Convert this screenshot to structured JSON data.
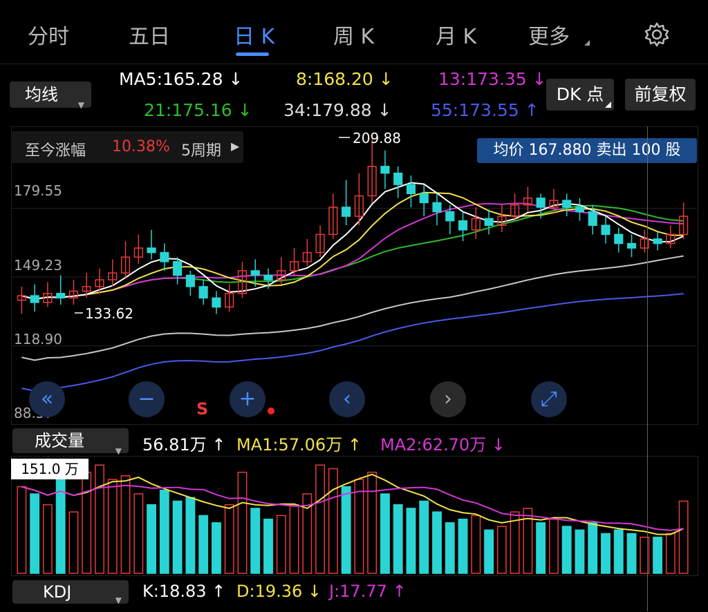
{
  "tabs": [
    {
      "label": "分时"
    },
    {
      "label": "五日"
    },
    {
      "label": "日 K"
    },
    {
      "label": "周 K"
    },
    {
      "label": "月 K"
    },
    {
      "label": "更多"
    }
  ],
  "ma_selector": "均线",
  "ma": {
    "ma5": "MA5:165.28 ↓",
    "ma8": "8:168.20 ↓",
    "ma13": "13:173.35 ↓",
    "ma21": "21:175.16 ↓",
    "ma34": "34:179.88 ↓",
    "ma55": "55:173.55 ↑"
  },
  "colors": {
    "ma5": "#ffffff",
    "ma8": "#f2e24a",
    "ma13": "#d436d4",
    "ma21": "#2dbb2d",
    "ma34": "#c8c8c8",
    "ma55": "#4a5ae8",
    "up": "#e83a3a",
    "down": "#2ad4d4",
    "accent": "#4a8cff"
  },
  "dk_button": "DK 点",
  "restore_button": "前复权",
  "gain": {
    "label": "至今涨幅",
    "value": "10.38%",
    "period": "5周期"
  },
  "avg_tooltip": "均价 167.880 卖出 100 股",
  "price_labels": [
    "179.55",
    "149.23",
    "118.90",
    "88.57"
  ],
  "annotations": {
    "high": "209.88",
    "low": "133.62"
  },
  "signal_s": "S",
  "volume": {
    "selector": "成交量",
    "value": "56.81万 ↑",
    "ma1": "MA1:57.06万 ↑",
    "ma2": "MA2:62.70万 ↓",
    "max_label": "151.0 万"
  },
  "kdj": {
    "selector": "KDJ",
    "k": "K:18.83 ↑",
    "d": "D:19.36 ↓",
    "j": "J:17.77 ↑"
  },
  "candles": [
    {
      "o": 139,
      "c": 141,
      "h": 145,
      "l": 133,
      "v": 120
    },
    {
      "o": 141,
      "c": 138,
      "h": 146,
      "l": 134,
      "v": 110
    },
    {
      "o": 138,
      "c": 142,
      "h": 147,
      "l": 136,
      "v": 95
    },
    {
      "o": 142,
      "c": 140,
      "h": 150,
      "l": 137,
      "v": 130
    },
    {
      "o": 140,
      "c": 143,
      "h": 148,
      "l": 137,
      "v": 85
    },
    {
      "o": 143,
      "c": 145,
      "h": 151,
      "l": 140,
      "v": 140
    },
    {
      "o": 145,
      "c": 148,
      "h": 153,
      "l": 142,
      "v": 150
    },
    {
      "o": 148,
      "c": 151,
      "h": 157,
      "l": 145,
      "v": 130
    },
    {
      "o": 151,
      "c": 158,
      "h": 165,
      "l": 149,
      "v": 135
    },
    {
      "o": 158,
      "c": 162,
      "h": 168,
      "l": 155,
      "v": 110
    },
    {
      "o": 162,
      "c": 160,
      "h": 170,
      "l": 157,
      "v": 95
    },
    {
      "o": 160,
      "c": 156,
      "h": 164,
      "l": 152,
      "v": 115
    },
    {
      "o": 156,
      "c": 150,
      "h": 158,
      "l": 146,
      "v": 100
    },
    {
      "o": 150,
      "c": 145,
      "h": 152,
      "l": 141,
      "v": 105
    },
    {
      "o": 145,
      "c": 140,
      "h": 148,
      "l": 137,
      "v": 80
    },
    {
      "o": 140,
      "c": 136,
      "h": 143,
      "l": 133,
      "v": 70
    },
    {
      "o": 136,
      "c": 142,
      "h": 146,
      "l": 134,
      "v": 95
    },
    {
      "o": 142,
      "c": 152,
      "h": 156,
      "l": 140,
      "v": 140
    },
    {
      "o": 152,
      "c": 150,
      "h": 157,
      "l": 145,
      "v": 90
    },
    {
      "o": 150,
      "c": 148,
      "h": 153,
      "l": 144,
      "v": 75
    },
    {
      "o": 148,
      "c": 152,
      "h": 158,
      "l": 146,
      "v": 80
    },
    {
      "o": 152,
      "c": 156,
      "h": 162,
      "l": 150,
      "v": 95
    },
    {
      "o": 156,
      "c": 160,
      "h": 166,
      "l": 154,
      "v": 110
    },
    {
      "o": 160,
      "c": 168,
      "h": 172,
      "l": 158,
      "v": 150
    },
    {
      "o": 168,
      "c": 180,
      "h": 186,
      "l": 166,
      "v": 145
    },
    {
      "o": 180,
      "c": 176,
      "h": 192,
      "l": 172,
      "v": 120
    },
    {
      "o": 176,
      "c": 185,
      "h": 195,
      "l": 172,
      "v": 130
    },
    {
      "o": 185,
      "c": 198,
      "h": 210,
      "l": 182,
      "v": 140
    },
    {
      "o": 198,
      "c": 195,
      "h": 205,
      "l": 188,
      "v": 110
    },
    {
      "o": 195,
      "c": 190,
      "h": 198,
      "l": 184,
      "v": 95
    },
    {
      "o": 190,
      "c": 186,
      "h": 194,
      "l": 180,
      "v": 90
    },
    {
      "o": 186,
      "c": 182,
      "h": 190,
      "l": 176,
      "v": 100
    },
    {
      "o": 182,
      "c": 178,
      "h": 186,
      "l": 172,
      "v": 85
    },
    {
      "o": 178,
      "c": 174,
      "h": 181,
      "l": 168,
      "v": 70
    },
    {
      "o": 174,
      "c": 170,
      "h": 178,
      "l": 165,
      "v": 75
    },
    {
      "o": 170,
      "c": 175,
      "h": 180,
      "l": 166,
      "v": 80
    },
    {
      "o": 175,
      "c": 172,
      "h": 179,
      "l": 168,
      "v": 60
    },
    {
      "o": 172,
      "c": 176,
      "h": 181,
      "l": 169,
      "v": 65
    },
    {
      "o": 176,
      "c": 181,
      "h": 186,
      "l": 174,
      "v": 85
    },
    {
      "o": 181,
      "c": 184,
      "h": 189,
      "l": 178,
      "v": 90
    },
    {
      "o": 184,
      "c": 180,
      "h": 186,
      "l": 175,
      "v": 70
    },
    {
      "o": 180,
      "c": 183,
      "h": 188,
      "l": 177,
      "v": 75
    },
    {
      "o": 183,
      "c": 180,
      "h": 186,
      "l": 176,
      "v": 65
    },
    {
      "o": 180,
      "c": 178,
      "h": 184,
      "l": 174,
      "v": 60
    },
    {
      "o": 178,
      "c": 172,
      "h": 181,
      "l": 168,
      "v": 70
    },
    {
      "o": 172,
      "c": 168,
      "h": 176,
      "l": 164,
      "v": 55
    },
    {
      "o": 168,
      "c": 164,
      "h": 171,
      "l": 160,
      "v": 60
    },
    {
      "o": 164,
      "c": 162,
      "h": 168,
      "l": 158,
      "v": 55
    },
    {
      "o": 162,
      "c": 166,
      "h": 170,
      "l": 160,
      "v": 50
    },
    {
      "o": 166,
      "c": 164,
      "h": 169,
      "l": 161,
      "v": 50
    },
    {
      "o": 164,
      "c": 168,
      "h": 172,
      "l": 162,
      "v": 55
    },
    {
      "o": 168,
      "c": 176,
      "h": 182,
      "l": 166,
      "v": 100
    }
  ]
}
